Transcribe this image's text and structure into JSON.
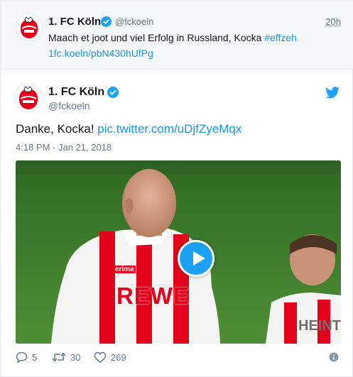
{
  "parent_tweet": {
    "display_name": "1. FC Köln",
    "handle": "@fckoeln",
    "time": "20h",
    "text_plain": "Maach et joot und viel Erfolg in Russland, Kocka ",
    "hashtag": "#effzeh",
    "link": "1fc.koeln/pbN430hUfPg"
  },
  "main_tweet": {
    "display_name": "1. FC Köln",
    "handle": "@fckoeln",
    "text_plain": "Danke, Kocka! ",
    "link": "pic.twitter.com/uDjfZyeMqx",
    "date": "4:18 PM - Jan 21, 2018"
  },
  "video": {
    "shirt_text": "REWE",
    "sleeve_brand": "erima",
    "second_player_name": "HEINT"
  },
  "actions": {
    "replies": "5",
    "retweets": "30",
    "likes": "269"
  },
  "colors": {
    "accent": "#1da1f2",
    "link": "#1b95e0",
    "muted": "#657786",
    "club_red": "#e3001b"
  },
  "icons": [
    "club-logo-icon",
    "verified-badge-icon",
    "twitter-bird-icon",
    "play-icon",
    "reply-icon",
    "retweet-icon",
    "heart-icon",
    "info-icon"
  ]
}
